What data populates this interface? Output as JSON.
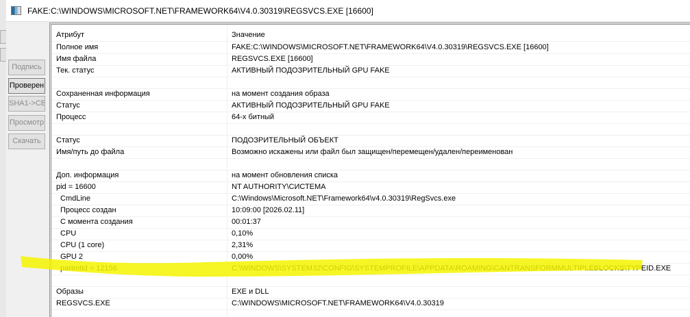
{
  "window": {
    "title": "FAKE:C:\\WINDOWS\\MICROSOFT.NET\\FRAMEWORK64\\V4.0.30319\\REGSVCS.EXE [16600]"
  },
  "side_buttons": [
    {
      "label": "Подпись",
      "enabled": false
    },
    {
      "label": "Проверен",
      "enabled": true
    },
    {
      "label": "SHA1->CB",
      "enabled": false
    },
    {
      "label": "Просмотр",
      "enabled": false
    },
    {
      "label": "Скачать",
      "enabled": false
    }
  ],
  "table": {
    "headers": [
      "Атрибут",
      "Значение"
    ],
    "rows": [
      {
        "attr": "Полное имя",
        "value": "FAKE:C:\\WINDOWS\\MICROSOFT.NET\\FRAMEWORK64\\V4.0.30319\\REGSVCS.EXE [16600]"
      },
      {
        "attr": "Имя файла",
        "value": "REGSVCS.EXE [16600]"
      },
      {
        "attr": "Тек. статус",
        "value": "АКТИВНЫЙ ПОДОЗРИТЕЛЬНЫЙ GPU FAKE"
      },
      {
        "attr": "",
        "value": ""
      },
      {
        "attr": "Сохраненная информация",
        "value": "на момент создания образа"
      },
      {
        "attr": "Статус",
        "value": "АКТИВНЫЙ ПОДОЗРИТЕЛЬНЫЙ GPU FAKE"
      },
      {
        "attr": "Процесс",
        "value": "64-х битный"
      },
      {
        "attr": "",
        "value": ""
      },
      {
        "attr": "Статус",
        "value": "ПОДОЗРИТЕЛЬНЫЙ ОБЪЕКТ"
      },
      {
        "attr": "Имя/путь до файла",
        "value": "Возможно искажены или файл был защищен/перемещен/удален/переименован"
      },
      {
        "attr": "",
        "value": ""
      },
      {
        "attr": "Доп. информация",
        "value": "на момент обновления списка"
      },
      {
        "attr": "pid = 16600",
        "value": "NT AUTHORITY\\СИСТЕМА"
      },
      {
        "attr": "CmdLine",
        "value": "C:\\Windows\\Microsoft.NET\\Framework64\\v4.0.30319\\RegSvcs.exe",
        "indent": true
      },
      {
        "attr": "Процесс создан",
        "value": "10:09:00 [2026.02.11]",
        "indent": true
      },
      {
        "attr": "С момента создания",
        "value": "00:01:37",
        "indent": true
      },
      {
        "attr": "CPU",
        "value": "0,10%",
        "indent": true
      },
      {
        "attr": "CPU (1 core)",
        "value": "2,31%",
        "indent": true
      },
      {
        "attr": "GPU 2",
        "value": "0,00%",
        "indent": true
      },
      {
        "attr": "parentid = 12156",
        "value": "C:\\WINDOWS\\SYSTEM32\\CONFIG\\SYSTEMPROFILE\\APPDATA\\ROAMING\\CANTRANSFORMMULTIPLEBLOCKS\\TYPEID.EXE",
        "indent": true,
        "highlighted": true
      },
      {
        "attr": "",
        "value": ""
      },
      {
        "attr": "Образы",
        "value": "EXE и DLL"
      },
      {
        "attr": "REGSVCS.EXE",
        "value": "C:\\WINDOWS\\MICROSOFT.NET\\FRAMEWORK64\\V4.0.30319"
      }
    ]
  },
  "colors": {
    "highlight": "#f5f500"
  }
}
